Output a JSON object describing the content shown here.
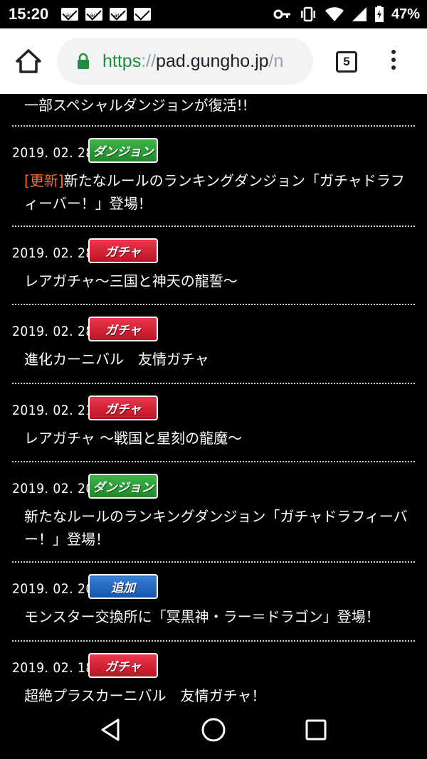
{
  "status_bar": {
    "time": "15:20",
    "mail_icons": [
      "au-mail-icon",
      "au-mail-icon",
      "au-mail-icon",
      "mail-icon"
    ],
    "battery_percent": "47%"
  },
  "browser": {
    "url_scheme": "https",
    "url_separator": "://",
    "url_host": "pad.gungho.jp",
    "url_rest": "/n",
    "tab_count": "5"
  },
  "news": {
    "partial_title": "一部スペシャルダンジョンが復活!!",
    "items": [
      {
        "date": "2019. 02. 28",
        "category": "ダンジョン",
        "tag": "[更新]",
        "title": "新たなルールのランキングダンジョン「ガチャドラフィーバー！」登場！"
      },
      {
        "date": "2019. 02. 28",
        "category": "ガチャ",
        "tag": "",
        "title": "レアガチャ〜三国と神天の龍誓〜"
      },
      {
        "date": "2019. 02. 28",
        "category": "ガチャ",
        "tag": "",
        "title": "進化カーニバル　友情ガチャ"
      },
      {
        "date": "2019. 02. 21",
        "category": "ガチャ",
        "tag": "",
        "title": "レアガチャ ～戦国と星刻の龍魔～"
      },
      {
        "date": "2019. 02. 20",
        "category": "ダンジョン",
        "tag": "",
        "title": "新たなルールのランキングダンジョン「ガチャドラフィーバー！」登場！"
      },
      {
        "date": "2019. 02. 20",
        "category": "追加",
        "tag": "",
        "title": "モンスター交換所に「冥黒神・ラー＝ドラゴン」登場！"
      },
      {
        "date": "2019. 02. 18",
        "category": "ガチャ",
        "tag": "",
        "title": "超絶プラスカーニバル　友情ガチャ！"
      }
    ]
  },
  "colors": {
    "dungeon_badge": "#1c8a28",
    "gacha_badge": "#c01226",
    "add_badge": "#1456ad",
    "update_tag": "#ff6a2b",
    "url_scheme": "#1e8e3e"
  }
}
